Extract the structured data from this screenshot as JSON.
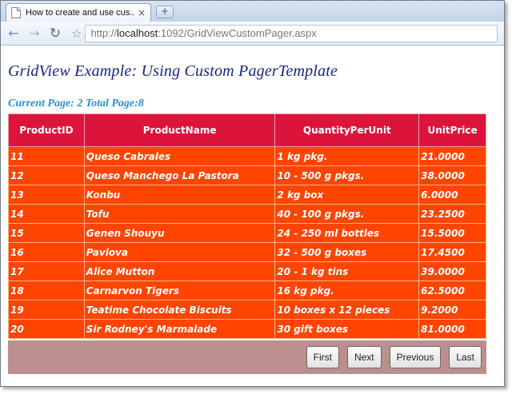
{
  "browser": {
    "tab_title": "How to create and use cus...",
    "tab_close": "×",
    "new_tab": "+",
    "back_icon": "←",
    "forward_icon": "→",
    "reload_icon": "↻",
    "star_icon": "☆",
    "url_prefix": "http://",
    "url_host": "localhost",
    "url_rest": ":1092/GridViewCustomPager.aspx"
  },
  "page": {
    "heading": "GridView Example: Using Custom PagerTemplate",
    "page_info": "Current Page: 2 Total Page:8"
  },
  "grid": {
    "columns": [
      "ProductID",
      "ProductName",
      "QuantityPerUnit",
      "UnitPrice"
    ],
    "rows": [
      [
        "11",
        "Queso Cabrales",
        "1 kg pkg.",
        "21.0000"
      ],
      [
        "12",
        "Queso Manchego La Pastora",
        "10 - 500 g pkgs.",
        "38.0000"
      ],
      [
        "13",
        "Konbu",
        "2 kg box",
        "6.0000"
      ],
      [
        "14",
        "Tofu",
        "40 - 100 g pkgs.",
        "23.2500"
      ],
      [
        "15",
        "Genen Shouyu",
        "24 - 250 ml bottles",
        "15.5000"
      ],
      [
        "16",
        "Pavlova",
        "32 - 500 g boxes",
        "17.4500"
      ],
      [
        "17",
        "Alice Mutton",
        "20 - 1 kg tins",
        "39.0000"
      ],
      [
        "18",
        "Carnarvon Tigers",
        "16 kg pkg.",
        "62.5000"
      ],
      [
        "19",
        "Teatime Chocolate Biscuits",
        "10 boxes x 12 pieces",
        "9.2000"
      ],
      [
        "20",
        "Sir Rodney's Marmalade",
        "30 gift boxes",
        "81.0000"
      ]
    ]
  },
  "pager": {
    "first": "First",
    "next": "Next",
    "previous": "Previous",
    "last": "Last"
  },
  "colors": {
    "header_bg": "#dc143c",
    "row_bg": "#ff4500",
    "pager_bg": "#bc8f8f",
    "heading": "#1a237e",
    "page_info": "#2a8fd6"
  }
}
